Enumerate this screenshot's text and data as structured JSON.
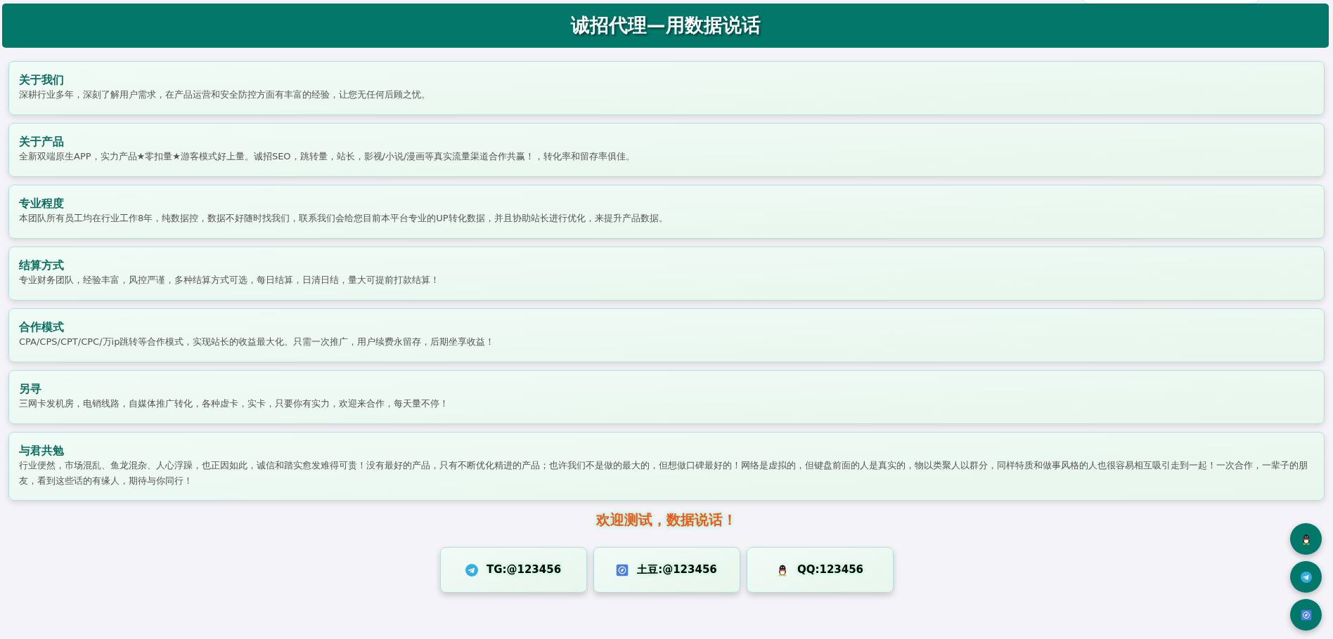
{
  "header": {
    "title": "诚招代理—用数据说话"
  },
  "sections": [
    {
      "title": "关于我们",
      "text": "深耕行业多年，深刻了解用户需求，在产品运营和安全防控方面有丰富的经验，让您无任何后顾之忧。"
    },
    {
      "title": "关于产品",
      "text": "全新双端原生APP，实力产品★零扣量★游客模式好上量。诚招SEO，跳转量，站长，影视/小说/漫画等真实流量渠道合作共赢！，转化率和留存率俱佳。"
    },
    {
      "title": "专业程度",
      "text": "本团队所有员工均在行业工作8年，纯数据控，数据不好随时找我们，联系我们会给您目前本平台专业的UP转化数据，并且协助站长进行优化，来提升产品数据。"
    },
    {
      "title": "结算方式",
      "text": "专业财务团队，经验丰富，风控严谨，多种结算方式可选，每日结算，日清日结，量大可提前打款结算！"
    },
    {
      "title": "合作模式",
      "text": "CPA/CPS/CPT/CPC/万ip跳转等合作模式，实现站长的收益最大化。只需一次推广，用户续费永留存，后期坐享收益！"
    },
    {
      "title": "另寻",
      "text": "三网卡发机房，电销线路，自媒体推广转化，各种虚卡，实卡，只要你有实力，欢迎来合作，每天量不停！"
    },
    {
      "title": "与君共勉",
      "text": "行业便然，市场混乱、鱼龙混杂、人心浮躁，也正因如此，诚信和踏实愈发难得可贵！没有最好的产品，只有不断优化精进的产品；也许我们不是做的最大的，但想做口碑最好的！网络是虚拟的，但键盘前面的人是真实的，物以类聚人以群分，同样特质和做事风格的人也很容易相互吸引走到一起！一次合作，一辈子的朋友，看到这些话的有缘人，期待与你同行！"
    }
  ],
  "slogan": "欢迎测试，数据说话！",
  "contacts": [
    {
      "kind": "plane",
      "label": "TG:@123456"
    },
    {
      "kind": "rocket",
      "label": "土豆:@123456"
    },
    {
      "kind": "penguin",
      "label": "QQ:123456"
    }
  ],
  "floating_buttons": [
    {
      "kind": "penguin"
    },
    {
      "kind": "plane"
    },
    {
      "kind": "rocket"
    }
  ]
}
